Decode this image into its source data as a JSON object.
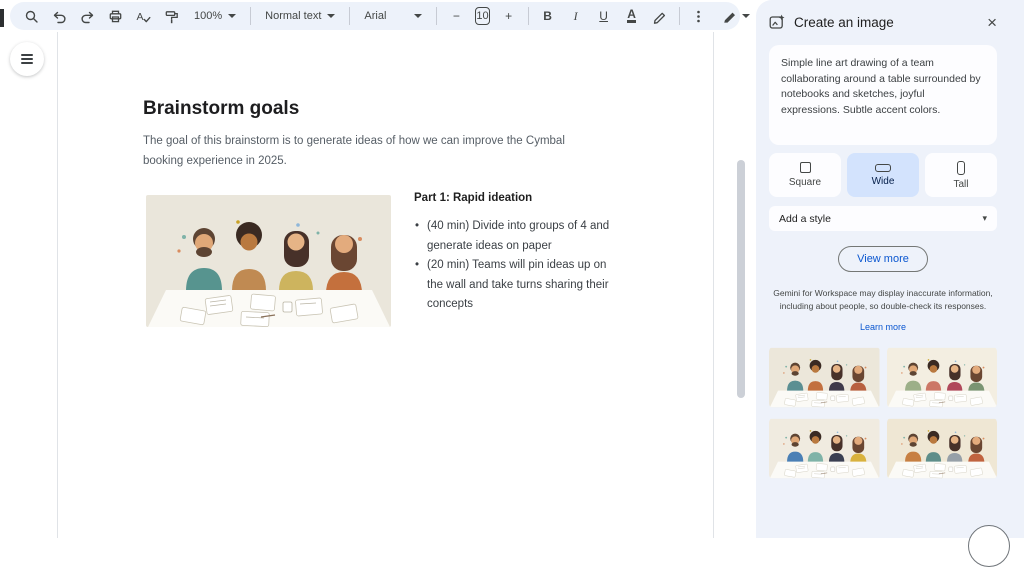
{
  "toolbar": {
    "zoom": "100%",
    "paragraph_style": "Normal text",
    "font": "Arial",
    "font_size": "10",
    "bold": "B",
    "italic": "I",
    "underline": "U",
    "text_color": "A",
    "minus": "−",
    "plus": "+"
  },
  "document": {
    "heading": "Brainstorm goals",
    "intro": "The goal of this brainstorm is to generate ideas of how we can improve the Cymbal booking experience in 2025.",
    "part1_heading": "Part 1: Rapid ideation",
    "bullets": [
      {
        "text": "(40 min) Divide into groups of 4 and generate ideas on paper"
      },
      {
        "text": "(20 min) Teams will pin ideas up on the wall and take turns sharing their concepts"
      }
    ]
  },
  "sidebar": {
    "title": "Create an image",
    "close": "×",
    "prompt": "Simple line art drawing of a team collaborating around a table surrounded by notebooks and sketches, joyful expressions. Subtle accent colors.",
    "aspect_options": [
      {
        "label": "Square"
      },
      {
        "label": "Wide"
      },
      {
        "label": "Tall"
      }
    ],
    "selected_aspect": "Wide",
    "style_placeholder": "Add a style",
    "view_more": "View more",
    "disclaimer": "Gemini for Workspace may display inaccurate information, including about people, so double-check its responses.",
    "learn_more": "Learn more",
    "style_caret": "▾"
  },
  "colors": {
    "accent_blue": "#0b57d0",
    "selected_chip_bg": "#d3e3fd",
    "panel_bg": "#eef2fa",
    "toolbar_bg": "#edf2fa"
  }
}
